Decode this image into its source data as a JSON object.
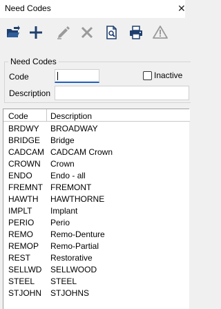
{
  "window": {
    "title": "Need Codes",
    "close_glyph": "✕"
  },
  "toolbar": {
    "buttons": [
      {
        "name": "open-icon",
        "tooltip": ""
      },
      {
        "name": "add-icon",
        "tooltip": ""
      },
      {
        "name": "edit-icon",
        "tooltip": ""
      },
      {
        "name": "delete-icon",
        "tooltip": ""
      },
      {
        "name": "preview-icon",
        "tooltip": ""
      },
      {
        "name": "print-icon",
        "tooltip": ""
      },
      {
        "name": "warning-icon",
        "tooltip": ""
      }
    ],
    "colors": {
      "active": "#1f3f6e",
      "disabled": "#9a9a9a"
    }
  },
  "filter": {
    "group_label": "Need Codes",
    "code_label": "Code",
    "code_value": "",
    "description_label": "Description",
    "description_value": "",
    "inactive_label": "Inactive",
    "inactive_checked": false
  },
  "grid": {
    "columns": [
      "Code",
      "Description"
    ],
    "rows": [
      {
        "code": "BRDWY",
        "description": "BROADWAY"
      },
      {
        "code": "BRIDGE",
        "description": "Bridge"
      },
      {
        "code": "CADCAM",
        "description": "CADCAM Crown"
      },
      {
        "code": "CROWN",
        "description": "Crown"
      },
      {
        "code": "ENDO",
        "description": "Endo - all"
      },
      {
        "code": "FREMNT",
        "description": "FREMONT"
      },
      {
        "code": "HAWTH",
        "description": "HAWTHORNE"
      },
      {
        "code": "IMPLT",
        "description": "Implant"
      },
      {
        "code": "PERIO",
        "description": "Perio"
      },
      {
        "code": "REMO",
        "description": "Remo-Denture"
      },
      {
        "code": "REMOP",
        "description": "Remo-Partial"
      },
      {
        "code": "REST",
        "description": "Restorative"
      },
      {
        "code": "SELLWD",
        "description": "SELLWOOD"
      },
      {
        "code": "STEEL",
        "description": "STEEL"
      },
      {
        "code": "STJOHN",
        "description": "STJOHNS"
      }
    ]
  }
}
